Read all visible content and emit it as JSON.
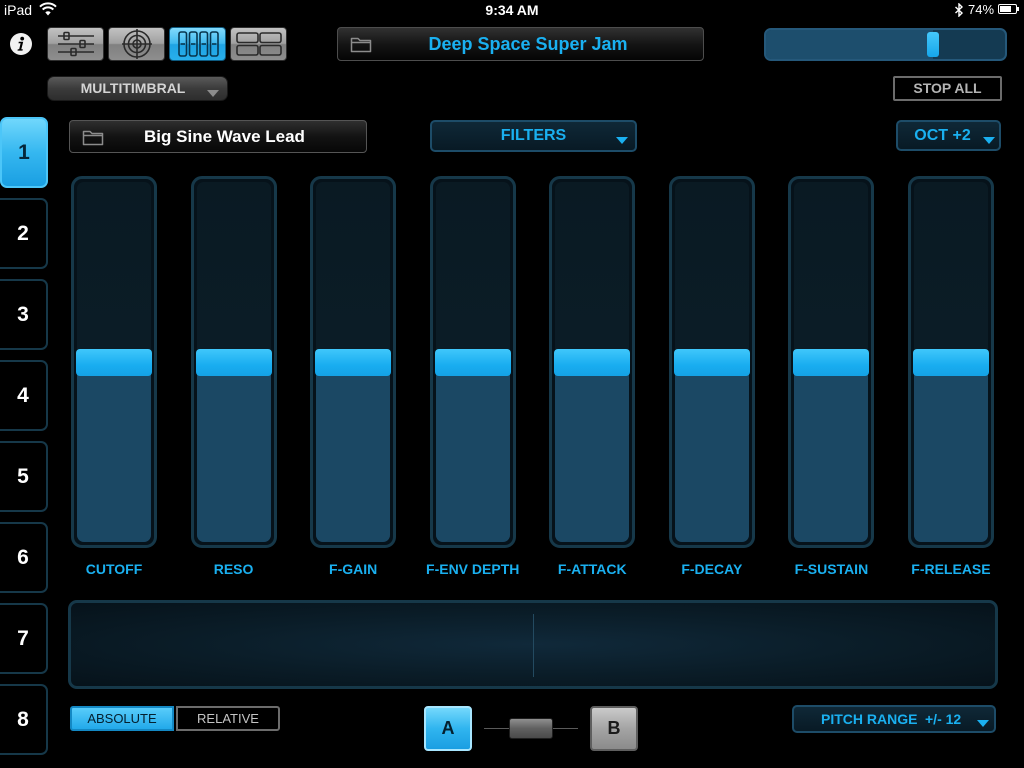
{
  "status_bar": {
    "device": "iPad",
    "time": "9:34 AM",
    "battery_text": "74%",
    "battery_level": 0.74,
    "wifi_icon": "wifi-icon",
    "bluetooth_icon": "bluetooth-icon",
    "battery_icon": "battery-icon"
  },
  "toolbar": {
    "info_icon": "info-icon",
    "view_modes": [
      {
        "icon": "mixer-sliders-icon",
        "active": false
      },
      {
        "icon": "target-icon",
        "active": false
      },
      {
        "icon": "vertical-faders-icon",
        "active": true
      },
      {
        "icon": "horizontal-grid-icon",
        "active": false
      }
    ],
    "project": {
      "icon": "folder-icon",
      "name": "Deep Space Super Jam"
    },
    "master_volume": 0.7
  },
  "header_controls": {
    "mode_select": {
      "value": "MULTITIMBRAL",
      "icon": "dropdown-arrow-icon"
    },
    "stop_all_label": "STOP ALL"
  },
  "channels": {
    "items": [
      "1",
      "2",
      "3",
      "4",
      "5",
      "6",
      "7",
      "8"
    ],
    "selected": "1"
  },
  "patch": {
    "icon": "folder-icon",
    "name": "Big Sine Wave Lead"
  },
  "page_select": {
    "value": "FILTERS",
    "icon": "dropdown-arrow-icon"
  },
  "octave_select": {
    "value": "OCT +2",
    "icon": "dropdown-arrow-icon"
  },
  "faders": [
    {
      "label": "CUTOFF",
      "value": 0.5
    },
    {
      "label": "RESO",
      "value": 0.5
    },
    {
      "label": "F-GAIN",
      "value": 0.5
    },
    {
      "label": "F-ENV DEPTH",
      "value": 0.5
    },
    {
      "label": "F-ATTACK",
      "value": 0.5
    },
    {
      "label": "F-DECAY",
      "value": 0.5
    },
    {
      "label": "F-SUSTAIN",
      "value": 0.5
    },
    {
      "label": "F-RELEASE",
      "value": 0.5
    }
  ],
  "footer": {
    "touch_mode": {
      "options": [
        "ABSOLUTE",
        "RELATIVE"
      ],
      "selected": "ABSOLUTE"
    },
    "ab_switch": {
      "a_label": "A",
      "b_label": "B",
      "selected": "A",
      "crossfade": 0.5
    },
    "pitch_range": {
      "label": "PITCH RANGE",
      "value": "+/- 12",
      "icon": "dropdown-arrow-icon"
    }
  },
  "colors": {
    "background": "#000000",
    "accent": "#1ab0f0",
    "fader_fill": "#1b4864",
    "frame": "#163849",
    "active_button": "#26acea",
    "inactive_button": "#8e8e8e"
  }
}
